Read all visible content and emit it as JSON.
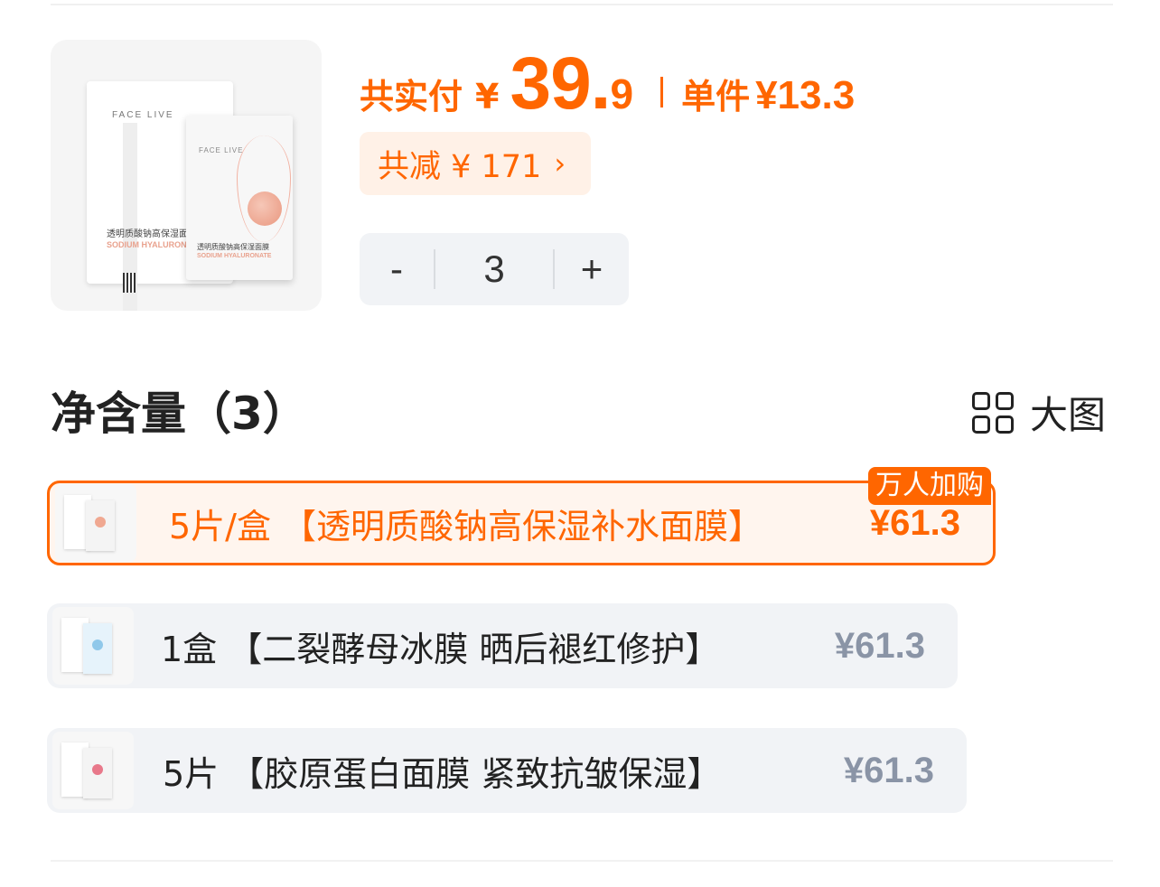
{
  "product": {
    "image_brand": "FACE LIVE",
    "image_title": "透明质酸钠高保湿面膜",
    "image_subtitle": "SODIUM HYALURONATE"
  },
  "price": {
    "label": "共实付",
    "currency": "¥",
    "integer": "39.",
    "decimal": "9",
    "unit_label": "单件",
    "unit_price": "¥13.3"
  },
  "discount": {
    "label": "共减 ¥ 171",
    "chevron": "›"
  },
  "stepper": {
    "minus": "-",
    "value": "3",
    "plus": "+"
  },
  "section": {
    "title": "净含量（3）",
    "view_toggle_label": "大图",
    "view_toggle_icon": "grid-icon"
  },
  "options": [
    {
      "label": "5片/盒 【透明质酸钠高保湿补水面膜】",
      "price": "¥61.3",
      "badge": "万人加购",
      "selected": true
    },
    {
      "label": "1盒 【二裂酵母冰膜  晒后褪红修护】",
      "price": "¥61.3",
      "selected": false
    },
    {
      "label": "5片 【胶原蛋白面膜  紧致抗皱保湿】",
      "price": "¥61.3",
      "selected": false
    }
  ],
  "colors": {
    "accent": "#ff6600",
    "chip_bg": "#fff1e7",
    "option_bg": "#f1f3f6",
    "muted_price": "#8a94a6"
  }
}
